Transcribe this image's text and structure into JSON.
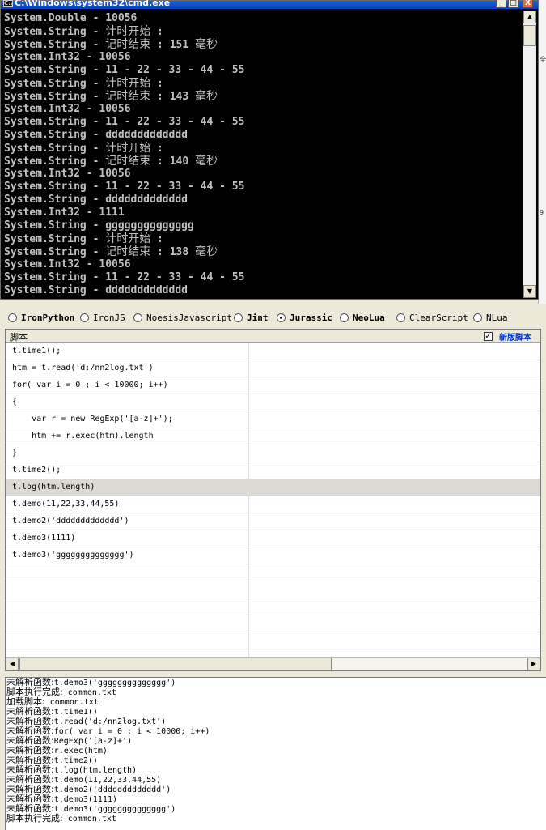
{
  "cmd_window": {
    "title": "C:\\Windows\\system32\\cmd.exe",
    "lines": [
      {
        "pre": "System.Double - 10056",
        "zh": "",
        "post": ""
      },
      {
        "pre": "System.String - ",
        "zh": "计时开始",
        "post": " :"
      },
      {
        "pre": "System.String - ",
        "zh": "记时结束",
        "post": " : 151 ",
        "zh2": "毫秒"
      },
      {
        "pre": "System.Int32 - 10056",
        "zh": "",
        "post": ""
      },
      {
        "pre": "System.String - 11 - 22 - 33 - 44 - 55",
        "zh": "",
        "post": ""
      },
      {
        "pre": "System.String - ",
        "zh": "计时开始",
        "post": " :"
      },
      {
        "pre": "System.String - ",
        "zh": "记时结束",
        "post": " : 143 ",
        "zh2": "毫秒"
      },
      {
        "pre": "System.Int32 - 10056",
        "zh": "",
        "post": ""
      },
      {
        "pre": "System.String - 11 - 22 - 33 - 44 - 55",
        "zh": "",
        "post": ""
      },
      {
        "pre": "System.String - ddddddddddddd",
        "zh": "",
        "post": ""
      },
      {
        "pre": "System.String - ",
        "zh": "计时开始",
        "post": " :"
      },
      {
        "pre": "System.String - ",
        "zh": "记时结束",
        "post": " : 140 ",
        "zh2": "毫秒"
      },
      {
        "pre": "System.Int32 - 10056",
        "zh": "",
        "post": ""
      },
      {
        "pre": "System.String - 11 - 22 - 33 - 44 - 55",
        "zh": "",
        "post": ""
      },
      {
        "pre": "System.String - ddddddddddddd",
        "zh": "",
        "post": ""
      },
      {
        "pre": "System.Int32 - 1111",
        "zh": "",
        "post": ""
      },
      {
        "pre": "System.String - gggggggggggggg",
        "zh": "",
        "post": ""
      },
      {
        "pre": "System.String - ",
        "zh": "计时开始",
        "post": " :"
      },
      {
        "pre": "System.String - ",
        "zh": "记时结束",
        "post": " : 138 ",
        "zh2": "毫秒"
      },
      {
        "pre": "System.Int32 - 10056",
        "zh": "",
        "post": ""
      },
      {
        "pre": "System.String - 11 - 22 - 33 - 44 - 55",
        "zh": "",
        "post": ""
      },
      {
        "pre": "System.String - ddddddddddddd",
        "zh": "",
        "post": ""
      }
    ],
    "buttons": {
      "minimize": "_",
      "maximize": "□",
      "close": "X"
    }
  },
  "engines": [
    {
      "label": "IronPython",
      "selected": false,
      "bold": true
    },
    {
      "label": "IronJS",
      "selected": false,
      "bold": false
    },
    {
      "label": "NoesisJavascript",
      "selected": false,
      "bold": false
    },
    {
      "label": "Jint",
      "selected": false,
      "bold": true
    },
    {
      "label": "Jurassic",
      "selected": true,
      "bold": true
    },
    {
      "label": "NeoLua",
      "selected": false,
      "bold": true
    },
    {
      "label": "ClearScript",
      "selected": false,
      "bold": false
    },
    {
      "label": "NLua",
      "selected": false,
      "bold": false
    }
  ],
  "script_grid": {
    "column_title": "脚本",
    "new_script_label": "新版脚本",
    "new_script_checked": true,
    "selected_row": 8,
    "rows": [
      "t.time1();",
      "htm = t.read('d:/nn2log.txt')",
      "for( var i = 0 ; i < 10000; i++)",
      "{",
      "    var r = new RegExp('[a-z]+');",
      "    htm += r.exec(htm).length",
      "}",
      "t.time2();",
      "t.log(htm.length)",
      "t.demo(11,22,33,44,55)",
      "t.demo2('ddddddddddddd')",
      "t.demo3(1111)",
      "t.demo3('gggggggggggggg')",
      "",
      "",
      "",
      "",
      "",
      ""
    ]
  },
  "log": [
    {
      "zh": "未解析函数:",
      "text": "t.demo3('gggggggggggggg')"
    },
    {
      "zh": "脚本执行完成:",
      "text": " common.txt"
    },
    {
      "zh": "加载脚本:",
      "text": " common.txt"
    },
    {
      "zh": "未解析函数:",
      "text": "t.time1()"
    },
    {
      "zh": "未解析函数:",
      "text": "t.read('d:/nn2log.txt')"
    },
    {
      "zh": "未解析函数:",
      "text": "for( var i = 0 ; i < 10000; i++)"
    },
    {
      "zh": "未解析函数:",
      "text": "RegExp('[a-z]+')"
    },
    {
      "zh": "未解析函数:",
      "text": "r.exec(htm)"
    },
    {
      "zh": "未解析函数:",
      "text": "t.time2()"
    },
    {
      "zh": "未解析函数:",
      "text": "t.log(htm.length)"
    },
    {
      "zh": "未解析函数:",
      "text": "t.demo(11,22,33,44,55)"
    },
    {
      "zh": "未解析函数:",
      "text": "t.demo2('ddddddddddddd')"
    },
    {
      "zh": "未解析函数:",
      "text": "t.demo3(1111)"
    },
    {
      "zh": "未解析函数:",
      "text": "t.demo3('gggggggggggggg')"
    },
    {
      "zh": "脚本执行完成:",
      "text": " common.txt"
    }
  ],
  "background_app": {
    "marks": [
      "全",
      "9"
    ]
  }
}
